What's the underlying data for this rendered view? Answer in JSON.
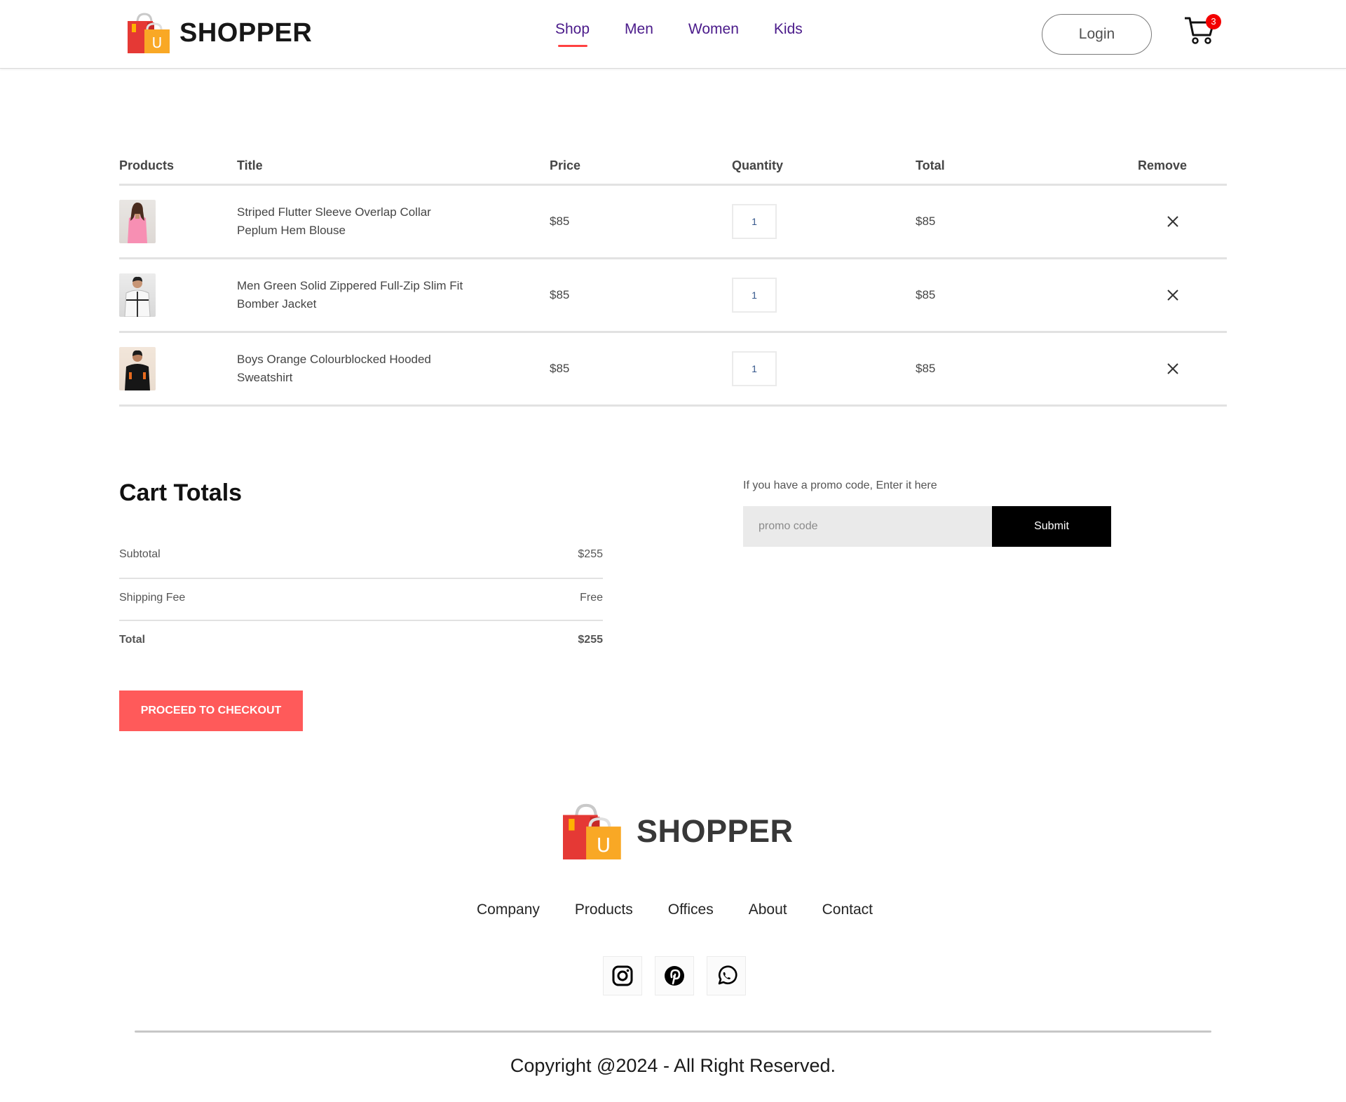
{
  "navbar": {
    "brand": "SHOPPER",
    "logo_letter": "U",
    "menu": [
      "Shop",
      "Men",
      "Women",
      "Kids"
    ],
    "active_menu": "Shop",
    "login_label": "Login",
    "cart_count": "3",
    "accent_color": "#ff4141",
    "menu_color": "#4a1a8a"
  },
  "cart": {
    "headers": {
      "products": "Products",
      "title": "Title",
      "price": "Price",
      "quantity": "Quantity",
      "total": "Total",
      "remove": "Remove"
    },
    "items": [
      {
        "title_line1": "Striped Flutter Sleeve Overlap Collar",
        "title_line2": "Peplum Hem Blouse",
        "price": "$85",
        "quantity": "1",
        "total": "$85"
      },
      {
        "title_line1": "Men Green Solid Zippered Full-Zip Slim Fit",
        "title_line2": "Bomber Jacket",
        "price": "$85",
        "quantity": "1",
        "total": "$85"
      },
      {
        "title_line1": "Boys Orange Colourblocked Hooded",
        "title_line2": "Sweatshirt",
        "price": "$85",
        "quantity": "1",
        "total": "$85"
      }
    ]
  },
  "totals": {
    "heading": "Cart Totals",
    "subtotal_label": "Subtotal",
    "subtotal_value": "$255",
    "shipping_label": "Shipping Fee",
    "shipping_value": "Free",
    "total_label": "Total",
    "total_value": "$255",
    "checkout_label": "PROCEED TO CHECKOUT",
    "checkout_color": "#ff5a5a"
  },
  "promo": {
    "label": "If you have a promo code, Enter it here",
    "placeholder": "promo code",
    "submit_label": "Submit"
  },
  "footer": {
    "brand": "SHOPPER",
    "logo_letter": "U",
    "links": [
      "Company",
      "Products",
      "Offices",
      "About",
      "Contact"
    ],
    "socials": [
      "instagram-icon",
      "pinterest-icon",
      "whatsapp-icon"
    ],
    "copyright": "Copyright @2024 - All Right Reserved."
  }
}
